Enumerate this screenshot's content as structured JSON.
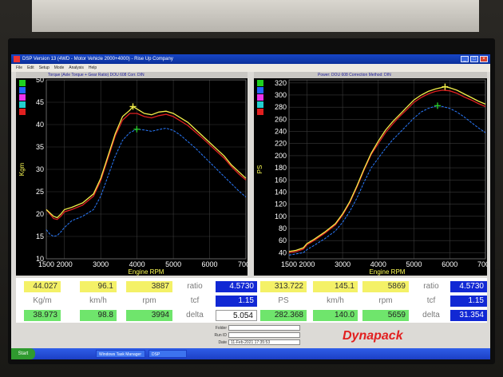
{
  "window": {
    "title": "DSP Version 13 (4WD - Motor Vehicle 2000+4000) - Rise Up Company"
  },
  "menu": [
    "File",
    "Edit",
    "Setup",
    "Mode",
    "Analysis",
    "Help"
  ],
  "colors": {
    "yellow": "#f2ee4a",
    "red": "#e02020",
    "green": "#28c828",
    "blue": "#2a7bff"
  },
  "side_colors": [
    "#1fd11f",
    "#2266ff",
    "#ee33ee",
    "#23d0d0",
    "#e21f1f"
  ],
  "torque": {
    "header": "Torque (Axle Torque + Gear Ratio) DOU 608      Corr. DIN",
    "ylabel": "Kgm",
    "xlabel": "Engine RPM",
    "yticks": [
      "50",
      "45",
      "40",
      "35",
      "30",
      "25",
      "20",
      "15",
      "10"
    ],
    "xticks": [
      "1500",
      "2000",
      "3000",
      "4000",
      "5000",
      "6000",
      "7000"
    ]
  },
  "power": {
    "header": "Power: DOU 608      Correction Method: DIN",
    "ylabel": "PS",
    "xlabel": "Engine RPM",
    "yticks": [
      "320",
      "300",
      "280",
      "260",
      "240",
      "220",
      "200",
      "180",
      "160",
      "140",
      "120",
      "100",
      "80",
      "60",
      "40"
    ],
    "xticks": [
      "1500",
      "2000",
      "3000",
      "4000",
      "5000",
      "6000",
      "7000"
    ]
  },
  "chart_data": [
    {
      "type": "line",
      "title": "Torque (Axle Torque + Gear Ratio) DOU 608",
      "xlabel": "Engine RPM",
      "ylabel": "Kgm",
      "xlim": [
        1500,
        7000
      ],
      "ylim": [
        10,
        50
      ],
      "series": [
        {
          "x": [
            1500,
            1700,
            1800,
            1900,
            2000,
            2200,
            2500,
            2800,
            3000,
            3200,
            3400,
            3600,
            3800,
            3887,
            4000,
            4200,
            4400,
            4600,
            4800,
            5000,
            5200,
            5400,
            5600,
            5800,
            6000,
            6200,
            6400,
            6600,
            6800,
            7000
          ],
          "values": [
            21,
            19.5,
            19.2,
            20,
            21,
            21.5,
            22.5,
            24.5,
            28,
            33,
            38,
            41.8,
            43.2,
            44.03,
            43.5,
            42.5,
            42.2,
            42.8,
            43,
            42.5,
            41.5,
            40.5,
            39,
            37.5,
            36,
            34.5,
            33,
            31,
            29.5,
            28
          ]
        },
        {
          "x": [
            1500,
            1700,
            1800,
            1900,
            2000,
            2200,
            2500,
            2800,
            3000,
            3200,
            3400,
            3600,
            3800,
            4000,
            4200,
            4400,
            4600,
            4800,
            5000,
            5200,
            5400,
            5600,
            5800,
            6000,
            6200,
            6400,
            6600,
            6800,
            7000
          ],
          "values": [
            21,
            19,
            18.8,
            19.5,
            20.5,
            21,
            22,
            24,
            27.5,
            32.5,
            37.5,
            41,
            42.5,
            42.5,
            41.8,
            41.5,
            42,
            42.3,
            41.8,
            40.8,
            39.8,
            38.4,
            37,
            35.5,
            34,
            32.5,
            30.6,
            29,
            27.6
          ]
        },
        {
          "x": [
            1500,
            1600,
            1700,
            1800,
            1900,
            2000,
            2200,
            2500,
            2800,
            3000,
            3200,
            3400,
            3600,
            3800,
            3994,
            4200,
            4400,
            4600,
            4800,
            5000,
            5200,
            5400,
            5600,
            5800,
            6000,
            6200,
            6400,
            6600,
            6800,
            7000
          ],
          "values": [
            16.5,
            15.5,
            15,
            15.2,
            16,
            17,
            18.5,
            19.5,
            21,
            24,
            28.5,
            33,
            36.5,
            38.2,
            38.97,
            38.8,
            38.5,
            38.9,
            39.2,
            38.7,
            37.6,
            36.2,
            34.8,
            33.2,
            31.6,
            30,
            28.4,
            26.8,
            25.2,
            23.8
          ]
        }
      ]
    },
    {
      "type": "line",
      "title": "Power",
      "xlabel": "Engine RPM",
      "ylabel": "PS",
      "xlim": [
        1500,
        7000
      ],
      "ylim": [
        30,
        325
      ],
      "series": [
        {
          "x": [
            1500,
            1700,
            1900,
            2000,
            2200,
            2500,
            2800,
            3000,
            3200,
            3400,
            3600,
            3800,
            4000,
            4200,
            4400,
            4600,
            4800,
            5000,
            5200,
            5400,
            5600,
            5869,
            6000,
            6200,
            6400,
            6600,
            6800,
            7000
          ],
          "values": [
            42,
            44,
            48,
            55,
            62,
            74,
            88,
            104,
            124,
            150,
            178,
            204,
            224,
            242,
            256,
            268,
            280,
            292,
            300,
            306,
            310,
            313.7,
            312,
            308,
            302,
            296,
            290,
            285
          ]
        },
        {
          "x": [
            1500,
            1700,
            1900,
            2000,
            2200,
            2500,
            2800,
            3000,
            3200,
            3400,
            3600,
            3800,
            4000,
            4200,
            4400,
            4600,
            4800,
            5000,
            5200,
            5400,
            5600,
            5800,
            6000,
            6200,
            6400,
            6600,
            6800,
            7000
          ],
          "values": [
            40,
            42,
            46,
            53,
            60,
            72,
            86,
            102,
            122,
            148,
            176,
            202,
            220,
            238,
            252,
            265,
            276,
            288,
            296,
            302,
            306,
            308,
            307,
            303,
            297,
            292,
            286,
            281
          ]
        },
        {
          "x": [
            1500,
            1700,
            1900,
            2000,
            2200,
            2500,
            2800,
            3000,
            3200,
            3400,
            3600,
            3800,
            4000,
            4200,
            4400,
            4600,
            4800,
            5000,
            5200,
            5400,
            5659,
            5800,
            6000,
            6200,
            6400,
            6600,
            6800,
            7000
          ],
          "values": [
            36,
            38,
            40,
            45,
            52,
            63,
            76,
            90,
            108,
            130,
            156,
            180,
            196,
            212,
            226,
            238,
            250,
            262,
            272,
            278,
            282.4,
            281,
            278,
            272,
            264,
            255,
            246,
            238
          ]
        }
      ]
    }
  ],
  "readout": {
    "row1": [
      {
        "value": "44.027",
        "style": "yel"
      },
      {
        "value": "96.1",
        "style": "yel"
      },
      {
        "value": "3887",
        "style": "yel"
      },
      {
        "value": "ratio",
        "style": "lbl"
      },
      {
        "value": "4.5730",
        "style": "blu"
      },
      {
        "value": "313.722",
        "style": "yel"
      },
      {
        "value": "145.1",
        "style": "yel"
      },
      {
        "value": "5869",
        "style": "yel"
      },
      {
        "value": "ratio",
        "style": "lbl"
      },
      {
        "value": "4.5730",
        "style": "blu"
      }
    ],
    "row2": [
      {
        "value": "Kg/m",
        "style": "lbl"
      },
      {
        "value": "km/h",
        "style": "lbl"
      },
      {
        "value": "rpm",
        "style": "lbl"
      },
      {
        "value": "tcf",
        "style": "lbl"
      },
      {
        "value": "1.15",
        "style": "blu"
      },
      {
        "value": "PS",
        "style": "lbl"
      },
      {
        "value": "km/h",
        "style": "lbl"
      },
      {
        "value": "rpm",
        "style": "lbl"
      },
      {
        "value": "tcf",
        "style": "lbl"
      },
      {
        "value": "1.15",
        "style": "blu"
      }
    ],
    "row3": [
      {
        "value": "38.973",
        "style": "grn"
      },
      {
        "value": "98.8",
        "style": "grn"
      },
      {
        "value": "3994",
        "style": "grn"
      },
      {
        "value": "delta",
        "style": "lbl"
      },
      {
        "value": "5.054",
        "style": "wht"
      },
      {
        "value": "282.368",
        "style": "grn"
      },
      {
        "value": "140.0",
        "style": "grn"
      },
      {
        "value": "5659",
        "style": "grn"
      },
      {
        "value": "delta",
        "style": "lbl"
      },
      {
        "value": "31.354",
        "style": "blu"
      }
    ]
  },
  "fields": {
    "folder_label": "Folder",
    "folder_value": "",
    "runid_label": "Run ID",
    "runid_value": "",
    "date_label": "Date",
    "date_value": "11-Feb-2021  17:35:53"
  },
  "logo": "Dynapack",
  "taskbar": {
    "start": "Start",
    "tasks": [
      "Windows Task Manager",
      "DSP"
    ],
    "clock": ""
  }
}
